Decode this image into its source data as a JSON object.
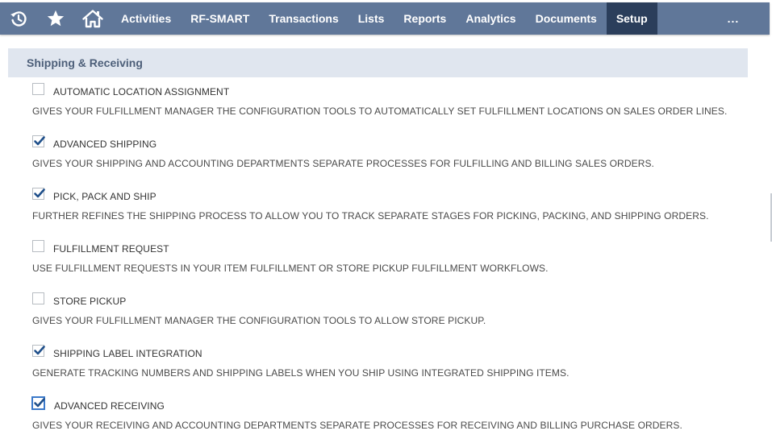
{
  "nav": {
    "icons": [
      "recent-history-icon",
      "star-icon",
      "home-icon"
    ],
    "items": [
      {
        "label": "Activities",
        "active": false
      },
      {
        "label": "RF-SMART",
        "active": false
      },
      {
        "label": "Transactions",
        "active": false
      },
      {
        "label": "Lists",
        "active": false
      },
      {
        "label": "Reports",
        "active": false
      },
      {
        "label": "Analytics",
        "active": false
      },
      {
        "label": "Documents",
        "active": false
      },
      {
        "label": "Setup",
        "active": true
      }
    ],
    "more": "...",
    "colors": {
      "bar": "#607799",
      "active": "#2b3e5b"
    }
  },
  "section": {
    "title": "Shipping & Receiving"
  },
  "features": [
    {
      "label": "AUTOMATIC LOCATION ASSIGNMENT",
      "checked": false,
      "description": "GIVES YOUR FULFILLMENT MANAGER THE CONFIGURATION TOOLS TO AUTOMATICALLY SET FULFILLMENT LOCATIONS ON SALES ORDER LINES."
    },
    {
      "label": "ADVANCED SHIPPING",
      "checked": true,
      "description": "GIVES YOUR SHIPPING AND ACCOUNTING DEPARTMENTS SEPARATE PROCESSES FOR FULFILLING AND BILLING SALES ORDERS."
    },
    {
      "label": "PICK, PACK AND SHIP",
      "checked": true,
      "description": "FURTHER REFINES THE SHIPPING PROCESS TO ALLOW YOU TO TRACK SEPARATE STAGES FOR PICKING, PACKING, AND SHIPPING ORDERS."
    },
    {
      "label": "FULFILLMENT REQUEST",
      "checked": false,
      "description": "USE FULFILLMENT REQUESTS IN YOUR ITEM FULFILLMENT OR STORE PICKUP FULFILLMENT WORKFLOWS."
    },
    {
      "label": "STORE PICKUP",
      "checked": false,
      "description": "GIVES YOUR FULFILLMENT MANAGER THE CONFIGURATION TOOLS TO ALLOW STORE PICKUP."
    },
    {
      "label": "SHIPPING LABEL INTEGRATION",
      "checked": true,
      "description": "GENERATE TRACKING NUMBERS AND SHIPPING LABELS WHEN YOU SHIP USING INTEGRATED SHIPPING ITEMS."
    },
    {
      "label": "ADVANCED RECEIVING",
      "checked": true,
      "focused": true,
      "description": "GIVES YOUR RECEIVING AND ACCOUNTING DEPARTMENTS SEPARATE PROCESSES FOR RECEIVING AND BILLING PURCHASE ORDERS."
    }
  ]
}
